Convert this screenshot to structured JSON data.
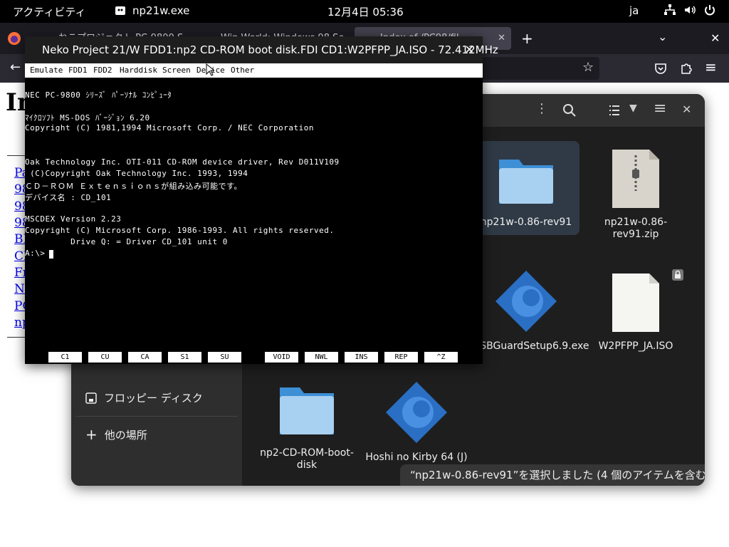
{
  "topbar": {
    "activities": "アクティビティ",
    "app_name": "np21w.exe",
    "clock": "12月4日 05:36",
    "ime": "ja"
  },
  "browser": {
    "tabs": [
      {
        "label": "ねこプロジェクト PC-9800 S"
      },
      {
        "label": "Win World: Windows 98 Se"
      },
      {
        "label": "Index of /PC98/fil"
      }
    ],
    "page": {
      "heading": "In",
      "links": [
        "Pa",
        "98",
        "98",
        "98",
        "BI",
        "CI",
        "Fr",
        "N",
        "PC",
        "np"
      ]
    }
  },
  "files": {
    "sidebar": {
      "floppy": "フロッピー ディスク",
      "other": "他の場所"
    },
    "items": [
      {
        "name": "np21w-0.86-rev91",
        "type": "folder"
      },
      {
        "name": "np21w-0.86-rev91.zip",
        "type": "zip"
      },
      {
        "name": "USBGuardSetup6.9.exe",
        "type": "exe"
      },
      {
        "name": "W2PFPP_JA.ISO",
        "type": "file"
      },
      {
        "name": "np2-CD-ROM-boot-disk",
        "type": "folder"
      },
      {
        "name": "Hoshi no Kirby 64 (J)",
        "type": "exe"
      }
    ],
    "status": "“np21w-0.86-rev91”を選択しました (4 個のアイテムを含む)"
  },
  "neko": {
    "title": "Neko Project 21/W  FDD1:np2 CD-ROM boot disk.FDI  CD1:W2PFPP_JA.ISO - 72.412MHz",
    "menu": [
      "Emulate",
      "FDD1",
      "FDD2",
      "Harddisk",
      "Screen",
      "Device",
      "Other"
    ],
    "screen_lines": [
      "NEC PC-9800 ｼﾘｰｽﾞ ﾊﾟｰｿﾅﾙ ｺﾝﾋﾟｭｰﾀ",
      "ﾏｲｸﾛｿﾌﾄ MS-DOS ﾊﾞｰｼﾞｮﾝ 6.20",
      "Copyright (C) 1981,1994 Microsoft Corp. / NEC Corporation",
      "Oak Technology Inc. OTI-011 CD-ROM device driver, Rev D011V109",
      " (C)Copyright Oak Technology Inc. 1993, 1994",
      "ＣＤ－ＲＯＭ Ｅｘｔｅｎｓｉｏｎｓが組み込み可能です。",
      "デバイス名 : CD_101",
      "MSCDEX Version 2.23",
      "Copyright (C) Microsoft Corp. 1986-1993. All rights reserved.",
      "         Drive Q: = Driver CD_101 unit 0",
      "A:\\>"
    ],
    "fkeys": [
      "C1",
      "CU",
      "CA",
      "S1",
      "SU",
      "VOID",
      "NWL",
      "INS",
      "REP",
      "^Z"
    ]
  }
}
